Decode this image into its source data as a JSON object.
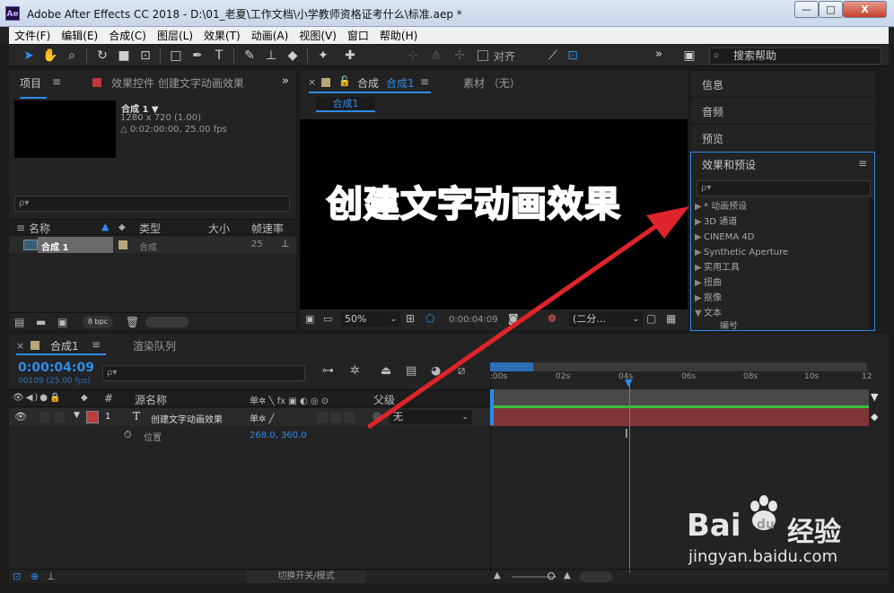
{
  "window": {
    "app_badge": "Ae",
    "title": "Adobe After Effects CC 2018 - D:\\01_老夏\\工作文档\\小学教师资格证考什么\\标准.aep *",
    "min_label": "—",
    "max_label": "□",
    "close_label": "X"
  },
  "menu": [
    "文件(F)",
    "编辑(E)",
    "合成(C)",
    "图层(L)",
    "效果(T)",
    "动画(A)",
    "视图(V)",
    "窗口",
    "帮助(H)"
  ],
  "toolbar": {
    "align_label": "对齐",
    "more_label": "»",
    "search_help": "搜索帮助"
  },
  "project": {
    "tab_label": "项目",
    "effects_control_tab": "效果控件 创建文字动画效果",
    "comp_name": "合成 1 ▼",
    "comp_res": "1280 x 720 (1.00)",
    "comp_duration": "△ 0:02:00:00, 25.00 fps",
    "search_placeholder": "ρ▾",
    "columns": [
      "名称",
      "类型",
      "大小",
      "帧速率"
    ],
    "item": {
      "name": "合成 1",
      "type": "合成",
      "fps": "25"
    },
    "bpc": "8 bpc"
  },
  "composition": {
    "tab_prefix": "合成",
    "tab_name": "合成1",
    "footage_tab": "素材 （无）",
    "breadcrumb": "合成1",
    "canvas_text": "创建文字动画效果",
    "zoom": "50%",
    "timecode": "0:00:04:09",
    "resolution": "(二分…"
  },
  "right_panels": {
    "info": "信息",
    "audio": "音频",
    "preview": "预览",
    "effects_title": "效果和预设",
    "effects_items": [
      "* 动画预设",
      "3D 通道",
      "CINEMA 4D",
      "Synthetic Aperture",
      "实用工具",
      "扭曲",
      "抠像",
      "文本",
      "编号"
    ]
  },
  "timeline": {
    "comp_tab": "合成1",
    "render_queue_tab": "渲染队列",
    "timecode": "0:00:04:09",
    "frames": "00109 (25.00 fps)",
    "search_placeholder": "ρ▾",
    "col_num": "#",
    "col_source": "源名称",
    "col_parent": "父级",
    "switch_icons": "单✲ ╲ fx ▣ ◐ ◎ ⊙",
    "layer_switch": "单✲ ╱",
    "layer": {
      "num": "1",
      "type": "T",
      "name": "创建文字动画效果",
      "parent": "无",
      "parent_icon": "◎"
    },
    "property": {
      "name": "位置",
      "value": "268.0, 360.0"
    },
    "ruler_ticks": [
      ":00s",
      "02s",
      "04s",
      "06s",
      "08s",
      "10s",
      "12"
    ],
    "toggle_label": "切换开关/模式",
    "cursor_glyph": "I"
  },
  "watermark": {
    "brand": "Bai",
    "brand_du": "du",
    "brand_cn": "经验",
    "url": "jingyan.baidu.com"
  },
  "colors": {
    "accent_blue": "#2d8ceb",
    "layer_red": "#c0393b",
    "arrow_red": "#e0242b",
    "panel_bg": "#232323"
  }
}
